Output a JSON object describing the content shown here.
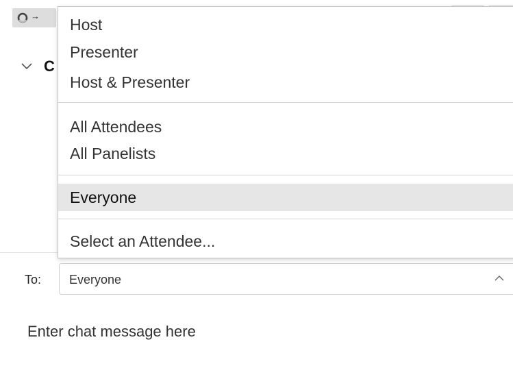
{
  "toolbar": {
    "arrow_glyph": "→"
  },
  "panel": {
    "section_title": "C"
  },
  "recipient": {
    "label": "To:",
    "selected": "Everyone"
  },
  "composer": {
    "placeholder": "Enter chat message here"
  },
  "dropdown": {
    "items": [
      {
        "label": "Host"
      },
      {
        "label": "Presenter"
      },
      {
        "label": "Host & Presenter"
      },
      {
        "label": "All Attendees"
      },
      {
        "label": "All Panelists"
      },
      {
        "label": "Everyone"
      },
      {
        "label": "Select an Attendee..."
      }
    ],
    "selected_label": "Everyone"
  },
  "colors": {
    "selected_item_bg": "#e6e6e6",
    "divider": "#d4d4d4",
    "icon_button_bg": "#dddddd"
  }
}
